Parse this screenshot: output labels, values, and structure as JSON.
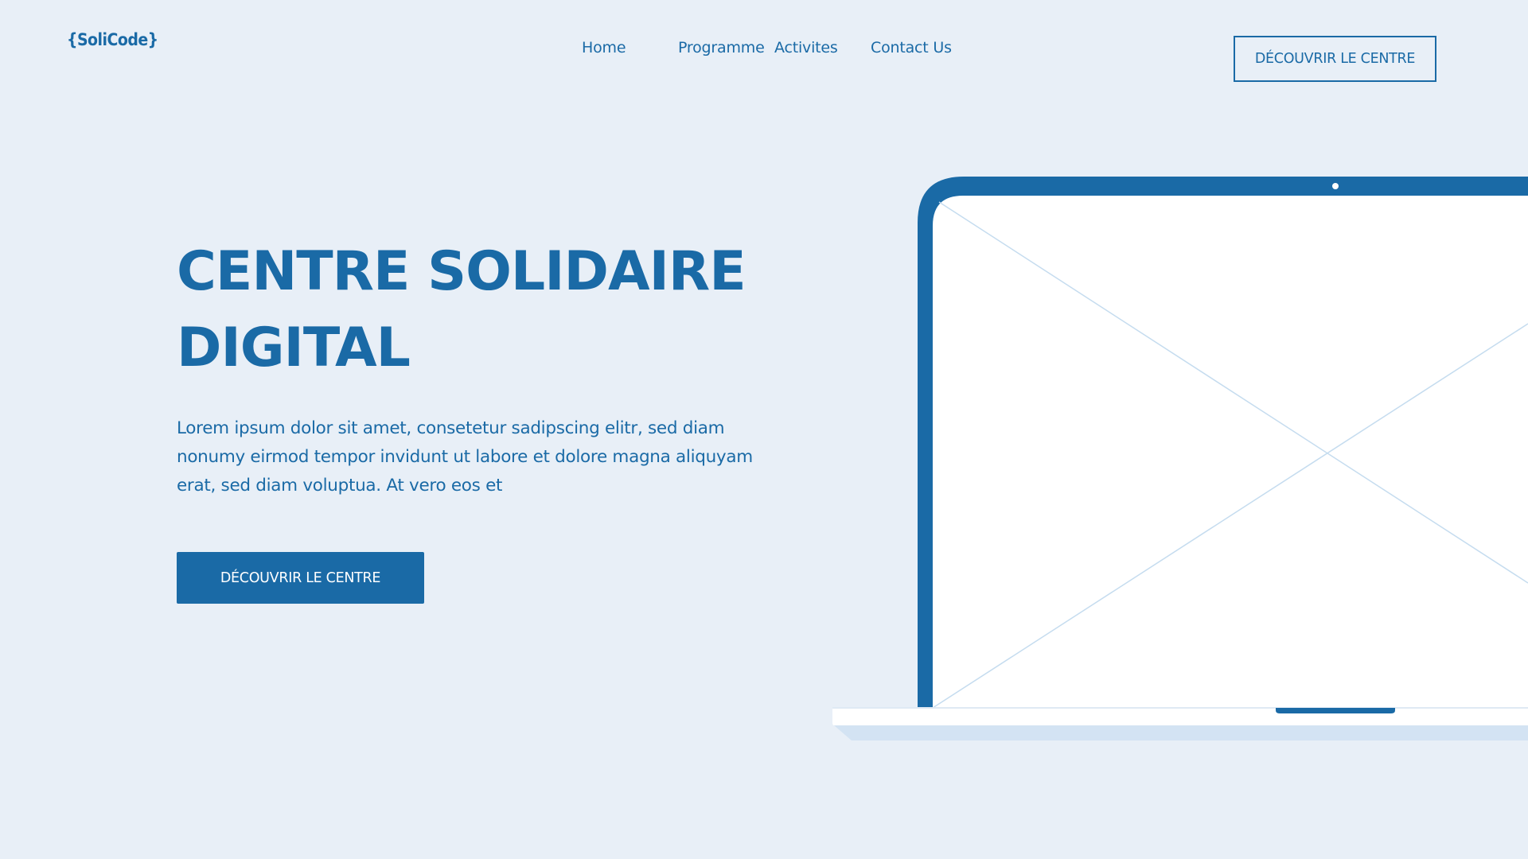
{
  "header": {
    "logo": "{SoliCode}",
    "nav": [
      {
        "label": "Home"
      },
      {
        "label": "Programme"
      },
      {
        "label": "Activites"
      },
      {
        "label": "Contact Us"
      }
    ],
    "cta_label": "DÉCOUVRIR LE CENTRE"
  },
  "hero": {
    "title_line1": "CENTRE SOLIDAIRE",
    "title_line2": "DIGITAL",
    "text": "Lorem ipsum dolor sit amet, consetetur sadipscing elitr, sed diam nonumy eirmod tempor invidunt ut labore et dolore magna aliquyam erat, sed diam voluptua. At vero eos et",
    "cta_label": "DÉCOUVRIR LE CENTRE"
  },
  "illustration": {
    "laptop_frame_color": "#1a6aa6",
    "screen_color": "#ffffff",
    "base_color": "#d3e3f3",
    "placeholder_line_color": "#c5dcef"
  },
  "colors": {
    "background": "#e8eff7",
    "brand": "#1a6aa6"
  }
}
